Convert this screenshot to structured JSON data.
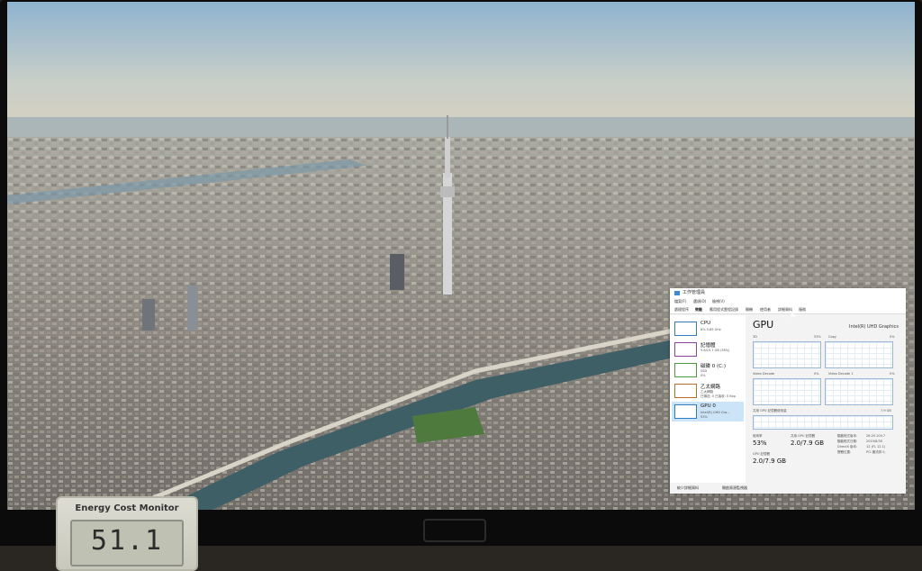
{
  "task_manager": {
    "window_title": "工作管理員",
    "menu": [
      "檔案(F)",
      "選項(O)",
      "檢視(V)"
    ],
    "tabs": [
      "處理程序",
      "效能",
      "應用程式歷程記錄",
      "開機",
      "使用者",
      "詳細資料",
      "服務"
    ],
    "active_tab": "效能",
    "sidebar": [
      {
        "name": "CPU",
        "sub": "8% 0.89 GHz",
        "sub2": ""
      },
      {
        "name": "記憶體",
        "sub": "5.6/15.7 GB (36%)",
        "sub2": ""
      },
      {
        "name": "磁碟 0 (C:)",
        "sub": "SSD",
        "sub2": "0%"
      },
      {
        "name": "乙太網路",
        "sub": "乙太網路",
        "sub2": "已傳送: 0 已接收: 0 Kbp"
      },
      {
        "name": "GPU 0",
        "sub": "Intel(R) UHD Gra...",
        "sub2": "53%"
      }
    ],
    "gpu_title": "GPU",
    "gpu_model": "Intel(R) UHD Graphics",
    "engines": [
      {
        "name": "3D",
        "value": "53%"
      },
      {
        "name": "Copy",
        "value": "0%"
      },
      {
        "name": "Video Decode",
        "value": "0%"
      },
      {
        "name": "Video Decode 1",
        "value": "0%"
      }
    ],
    "shared_memory_label": "共用 GPU 記憶體使用量",
    "shared_memory_max": "7.9 GB",
    "stats": [
      {
        "label": "使用率",
        "value": "53%"
      },
      {
        "label": "共用 GPU 記憶體",
        "value": "2.0/7.9 GB"
      },
      {
        "label": "GPU 記憶體",
        "value": "2.0/7.9 GB"
      }
    ],
    "info": [
      {
        "key": "驅動程式版本:",
        "value": "26.20.100.7"
      },
      {
        "key": "驅動程式日期:",
        "value": "2019/8/30"
      },
      {
        "key": "DirectX 版本:",
        "value": "12 (FL 12.1)"
      },
      {
        "key": "實體位置:",
        "value": "PCI 匯流排 0,"
      }
    ],
    "footer": {
      "fewer_details": "較少詳細資料",
      "open_monitor": "開啟資源監視器"
    }
  },
  "energy_meter": {
    "label": "Energy Cost Monitor",
    "reading": "51.1"
  },
  "colors": {
    "accent": "#3a8ad6",
    "selection": "#cce4f7",
    "graph_border": "#9ab8d6"
  }
}
